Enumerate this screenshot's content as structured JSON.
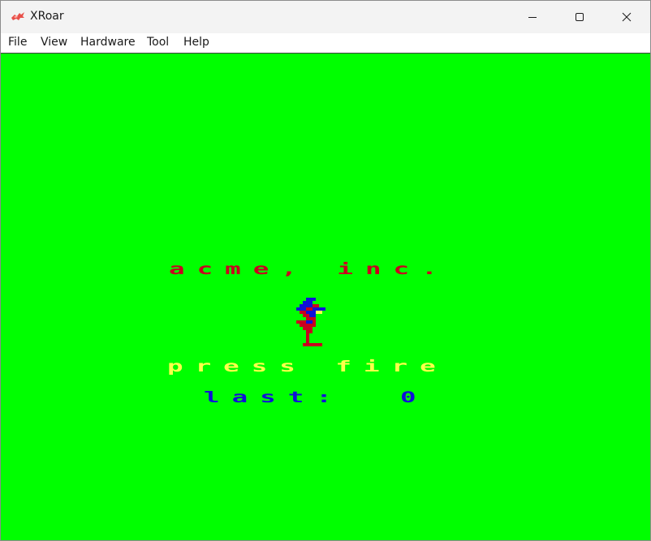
{
  "window": {
    "title": "XRoar",
    "icon": "xroar-dragon-icon"
  },
  "menu": {
    "items": [
      "File",
      "View",
      "Hardware",
      "Tool",
      "Help"
    ]
  },
  "screen": {
    "background_color": "#00ff00",
    "company_text": "acme, inc.",
    "prompt_text": "press fire",
    "score_label": "last:",
    "score_value": "0",
    "colors": {
      "company": "#c8001e",
      "prompt": "#ffff4a",
      "score": "#1010d8"
    }
  }
}
